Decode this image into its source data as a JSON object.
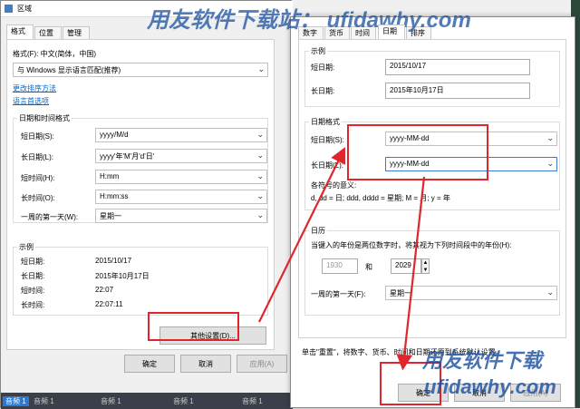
{
  "region_dialog": {
    "title": "区域",
    "tabs": [
      "格式",
      "位置",
      "管理"
    ],
    "format_label": "格式(F): 中文(简体，中国)",
    "format_value": "与 Windows 显示语言匹配(推荐)",
    "link_sort": "更改排序方法",
    "link_lang": "语言首选项",
    "datetime_group": "日期和时间格式",
    "rows": [
      {
        "label": "短日期(S):",
        "value": "yyyy/M/d"
      },
      {
        "label": "长日期(L):",
        "value": "yyyy'年'M'月'd'日'"
      },
      {
        "label": "短时间(H):",
        "value": "H:mm"
      },
      {
        "label": "长时间(O):",
        "value": "H:mm:ss"
      },
      {
        "label": "一周的第一天(W):",
        "value": "星期一"
      }
    ],
    "sample_group": "示例",
    "samples": [
      {
        "label": "短日期:",
        "value": "2015/10/17"
      },
      {
        "label": "长日期:",
        "value": "2015年10月17日"
      },
      {
        "label": "短时间:",
        "value": "22:07"
      },
      {
        "label": "长时间:",
        "value": "22:07:11"
      }
    ],
    "other_settings": "其他设置(D)...",
    "ok": "确定",
    "cancel": "取消",
    "apply": "应用(A)"
  },
  "custom_dialog": {
    "tabs": [
      "数字",
      "货币",
      "时间",
      "日期",
      "排序"
    ],
    "sample_group": "示例",
    "short_date_label": "短日期:",
    "short_date_value": "2015/10/17",
    "long_date_label": "长日期:",
    "long_date_value": "2015年10月17日",
    "date_format_group": "日期格式",
    "short_date_fmt_label": "短日期(S):",
    "short_date_fmt_value": "yyyy-MM-dd",
    "long_date_fmt_label": "长日期(L):",
    "long_date_fmt_value": "yyyy-MM-dd",
    "meaning_title": "各符号的意义:",
    "meaning_text": "d, dd = 日; ddd, dddd = 星期; M = 月; y = 年",
    "calendar_group": "日历",
    "calendar_desc": "当键入的年份是两位数字时，将其视为下列时间段中的年份(H):",
    "year_from": "1930",
    "year_and": "和",
    "year_to": "2029",
    "first_day_label": "一周的第一天(F):",
    "first_day_value": "星期一",
    "reset_note": "单击\"重置\"，将数字、货币、时间和日期还原到系统默认设置。",
    "ok": "确定",
    "cancel": "取消",
    "apply": "应用(A)"
  },
  "taskbar": {
    "items": [
      "音频 1",
      "音频 1",
      "音频 1",
      "音频 1",
      "音频 1"
    ]
  },
  "watermark": {
    "top": "用友软件下载站： ufidawhy.com",
    "bottom_cn": "用友软件下载",
    "bottom_url": "ufidawhy.com"
  },
  "colors": {
    "highlight": "#e0262c",
    "link": "#0066cc",
    "watermark": "#1a4fa0"
  }
}
